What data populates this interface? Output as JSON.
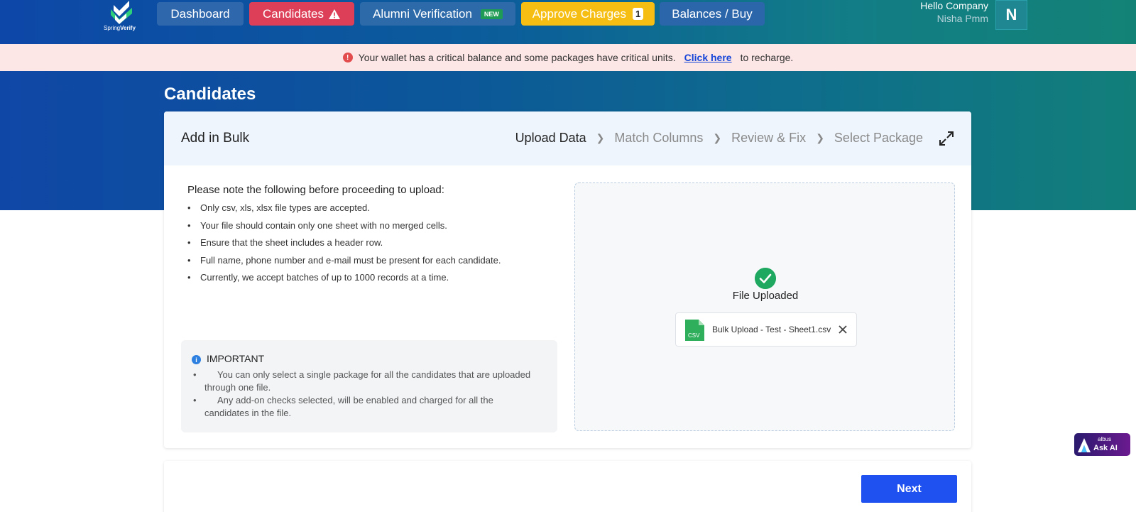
{
  "brand": {
    "logo_text_light": "Spring",
    "logo_text_bold": "Verify"
  },
  "nav": {
    "dashboard": "Dashboard",
    "candidates": "Candidates",
    "alumni": "Alumni Verification",
    "alumni_badge": "NEW",
    "approve": "Approve Charges",
    "approve_count": "1",
    "balances": "Balances / Buy"
  },
  "user": {
    "greeting": "Hello Company",
    "name": "Nisha Pmm",
    "initial": "N"
  },
  "alert": {
    "message": "Your wallet has a critical balance and some packages have critical units.",
    "link": "Click here",
    "suffix": "to recharge."
  },
  "page": {
    "title": "Candidates"
  },
  "card": {
    "title": "Add in Bulk",
    "steps": [
      "Upload Data",
      "Match Columns",
      "Review & Fix",
      "Select Package"
    ]
  },
  "notes": {
    "title": "Please note the following before proceeding to upload:",
    "items": [
      "Only csv, xls, xlsx file types are accepted.",
      "Your file should contain only one sheet with no merged cells.",
      "Ensure that the sheet includes a header row.",
      "Full name, phone number and e-mail must be present for each candidate.",
      "Currently, we accept batches of up to 1000 records at a time."
    ]
  },
  "important": {
    "title": "IMPORTANT",
    "items": [
      "You can only select a single package for all the candidates that are uploaded through one file.",
      "Any add-on checks selected, will be enabled and charged for all the candidates in the file."
    ]
  },
  "upload": {
    "status": "File Uploaded",
    "file_name": "Bulk Upload - Test - Sheet1.csv",
    "file_type": "CSV"
  },
  "footer": {
    "next_label": "Next"
  },
  "ask_ai": {
    "brand": "albus",
    "label": "Ask AI"
  },
  "colors": {
    "candidates_btn": "#dc3f57",
    "approve_btn": "#f6be12",
    "next_btn": "#1f50f0",
    "success": "#1fa85f",
    "alert_bg": "#fde6e6"
  }
}
